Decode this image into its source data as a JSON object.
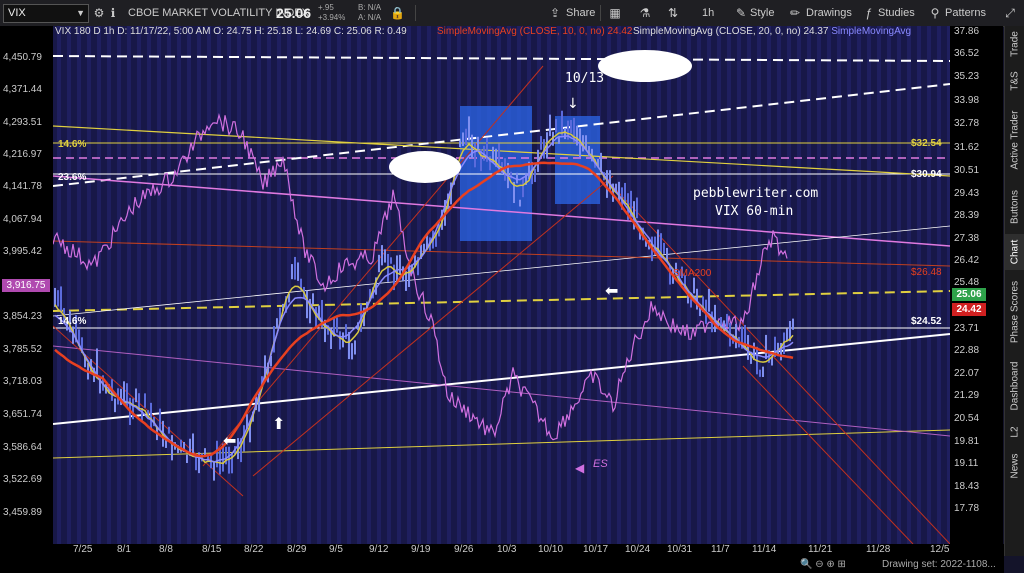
{
  "symbol": "VIX",
  "instrument_name": "CBOE MARKET VOLATILITY INDEX",
  "last_price": "25.06",
  "change": "+.95",
  "change_pct": "+3.94%",
  "bid": "B: N/A",
  "ask": "A: N/A",
  "toolbar": {
    "share": "Share",
    "timeframe": "1h",
    "style": "Style",
    "drawings": "Drawings",
    "studies": "Studies",
    "patterns": "Patterns"
  },
  "legend": {
    "ohlc": "VIX 180 D 1h  D: 11/17/22, 5:00 AM  O: 24.75  H: 25.18  L: 24.69  C: 25.06  R: 0.49",
    "sma10_label": "SimpleMovingAvg (CLOSE, 10, 0, no)",
    "sma10_value": "24.42",
    "sma20_label": "SimpleMovingAvg (CLOSE, 20, 0, no)",
    "sma20_value": "24.37",
    "sma_more": "SimpleMovingAvg"
  },
  "left_axis_ticks": [
    "4,450.79",
    "4,371.44",
    "4,293.51",
    "4,216.97",
    "4,141.78",
    "4,067.94",
    "3,995.42",
    "3,916.75",
    "3,854.23",
    "3,785.52",
    "3,718.03",
    "3,651.74",
    "3,586.64",
    "3,522.69",
    "3,459.89"
  ],
  "left_price_tag": "3,916.75",
  "right_axis_ticks": [
    "37.86",
    "36.52",
    "35.23",
    "33.98",
    "32.78",
    "31.62",
    "30.51",
    "29.43",
    "28.39",
    "27.38",
    "26.42",
    "25.48",
    "24.57",
    "23.71",
    "22.88",
    "22.07",
    "21.29",
    "20.54",
    "19.81",
    "19.11",
    "18.43",
    "17.78"
  ],
  "right_tags": {
    "last": "25.06",
    "sma10": "24.42",
    "lvl_32": "$32.54",
    "lvl_30": "$30.94",
    "lvl_26": "$26.48",
    "lvl_24": "$24.52"
  },
  "x_axis_ticks": [
    "7/25",
    "8/1",
    "8/8",
    "8/15",
    "8/22",
    "8/29",
    "9/5",
    "9/12",
    "9/19",
    "9/26",
    "10/3",
    "10/10",
    "10/17",
    "10/24",
    "10/31",
    "11/7",
    "11/14",
    "11/21",
    "11/28",
    "12/5"
  ],
  "annotations": {
    "fib_146_top": "14.6%",
    "fib_236": "23.6%",
    "fib_146_bottom": "14.6%",
    "date_1013": "10/13",
    "watermark_line1": "pebblewriter.com",
    "watermark_line2": "VIX 60-min",
    "sma200": "SMA200",
    "es": "ES"
  },
  "right_nav": [
    "Trade",
    "T&S",
    "Active Trader",
    "Buttons",
    "Chart",
    "Phase Scores",
    "Dashboard",
    "L2",
    "News"
  ],
  "status": {
    "drawing_set": "Drawing set: 2022-1108..."
  },
  "colors": {
    "plot_bg": "#181848",
    "candle": "#5b6bdc",
    "sma_red": "#e84020",
    "sma_yellow": "#d8c840",
    "sma_blue": "#8a8aff",
    "es_line": "#d070e0",
    "fib_yellow": "#e0d040",
    "highlight_box": "#2a62e0"
  }
}
